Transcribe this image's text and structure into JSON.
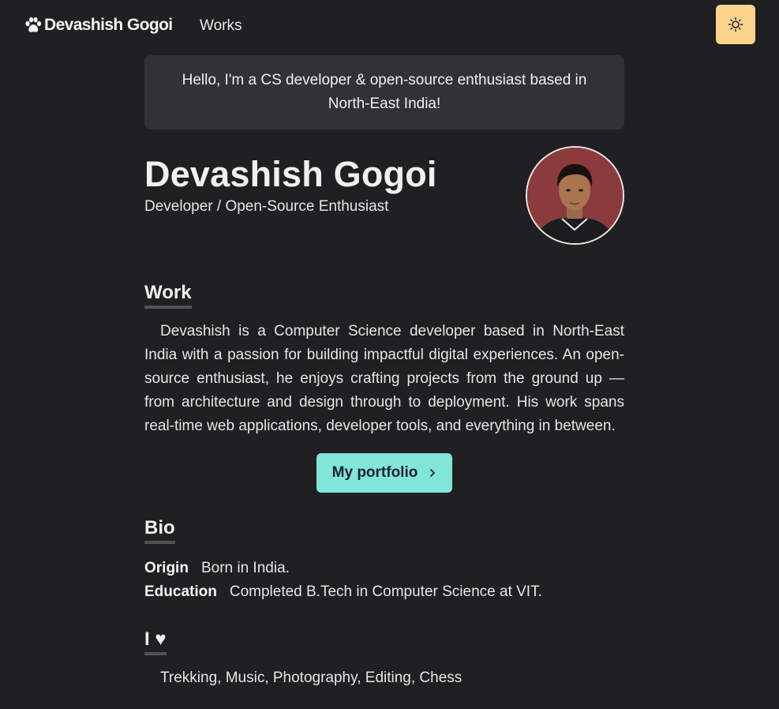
{
  "nav": {
    "logo_text": "Devashish Gogoi",
    "logo_icon": "paw-icon",
    "links": [
      {
        "label": "Works"
      }
    ],
    "theme_toggle_icon": "sun-icon",
    "theme_toggle_color": "#fbd38d"
  },
  "greeting": "Hello, I'm a CS developer & open-source enthusiast based in North-East India!",
  "hero": {
    "name": "Devashish Gogoi",
    "subtitle": "Developer / Open-Source Enthusiast",
    "avatar": "profile-photo"
  },
  "work": {
    "heading": "Work",
    "paragraph": "Devashish is a Computer Science developer based in North-East India with a passion for building impactful digital experiences. An open-source enthusiast, he enjoys crafting projects from the ground up — from architecture and design through to deployment. His work spans real-time web applications, developer tools, and everything in between.",
    "cta_label": "My portfolio",
    "cta_icon": "chevron-right-icon",
    "cta_color": "#81e6d9"
  },
  "bio": {
    "heading": "Bio",
    "items": [
      {
        "label": "Origin",
        "text": "Born in India."
      },
      {
        "label": "Education",
        "text": "Completed B.Tech in Computer Science at VIT."
      }
    ]
  },
  "love": {
    "heading": "I ♥",
    "text": "Trekking, Music, Photography, Editing, Chess"
  },
  "colors": {
    "background": "#202023",
    "card": "#323236",
    "text": "#ececec"
  }
}
